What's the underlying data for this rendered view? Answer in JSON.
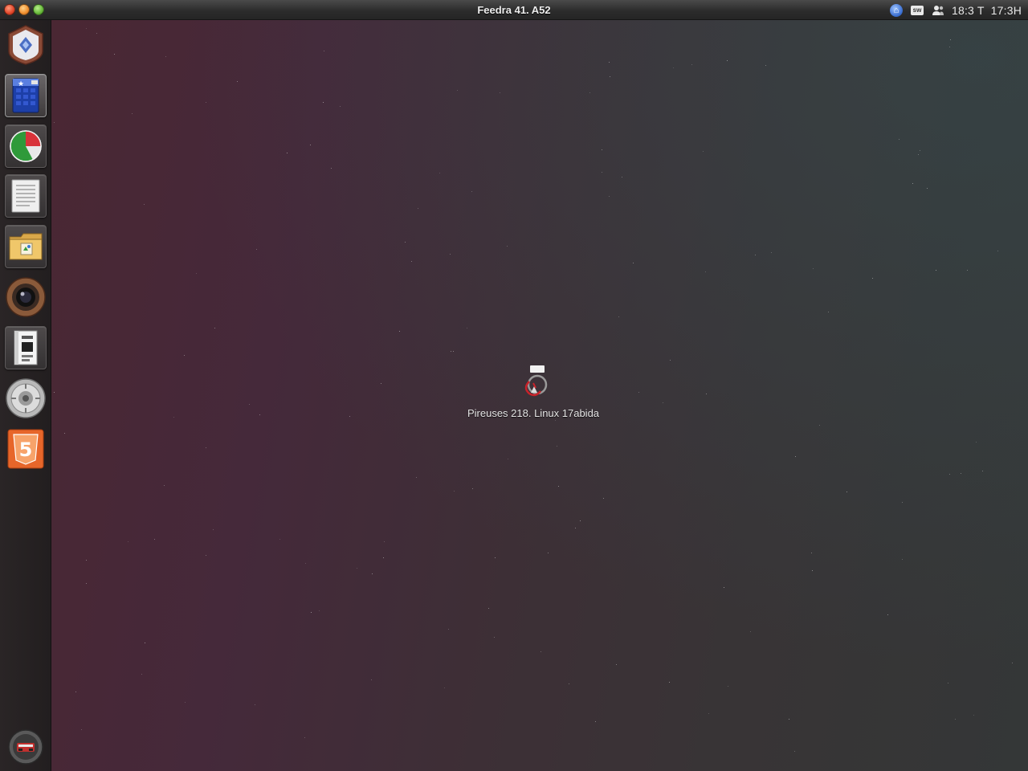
{
  "panel": {
    "title": "Feedra 41. A52",
    "window_buttons": [
      "close",
      "minimize",
      "maximize"
    ],
    "indicators": [
      {
        "name": "network-icon"
      },
      {
        "name": "messaging-icon",
        "label": "sw"
      },
      {
        "name": "user-icon"
      }
    ],
    "time_primary": "18:3 T",
    "time_secondary": "17:3H"
  },
  "desktop": {
    "center_label": "Pireuses 218. Linux 17abida"
  },
  "launcher": {
    "items": [
      {
        "name": "launcher-home-app",
        "icon": "shield-icon"
      },
      {
        "name": "launcher-calendar-app",
        "icon": "calendar-icon",
        "active": true
      },
      {
        "name": "launcher-chart-app",
        "icon": "pie-chart-icon"
      },
      {
        "name": "launcher-text-editor",
        "icon": "document-icon"
      },
      {
        "name": "launcher-files",
        "icon": "folder-icon"
      },
      {
        "name": "launcher-camera",
        "icon": "camera-lens-icon"
      },
      {
        "name": "launcher-document-viewer",
        "icon": "book-icon"
      },
      {
        "name": "launcher-settings",
        "icon": "gear-disk-icon"
      },
      {
        "name": "launcher-html5",
        "icon": "html5-icon",
        "label": "5"
      }
    ],
    "bottom_item": {
      "name": "launcher-trash",
      "icon": "trash-icon"
    }
  },
  "colors": {
    "panel_bg": "#2c2c2c",
    "accent_orange": "#e7662a",
    "close_red": "#e0462a",
    "min_orange": "#ef8e2e",
    "max_green": "#67b83a"
  }
}
